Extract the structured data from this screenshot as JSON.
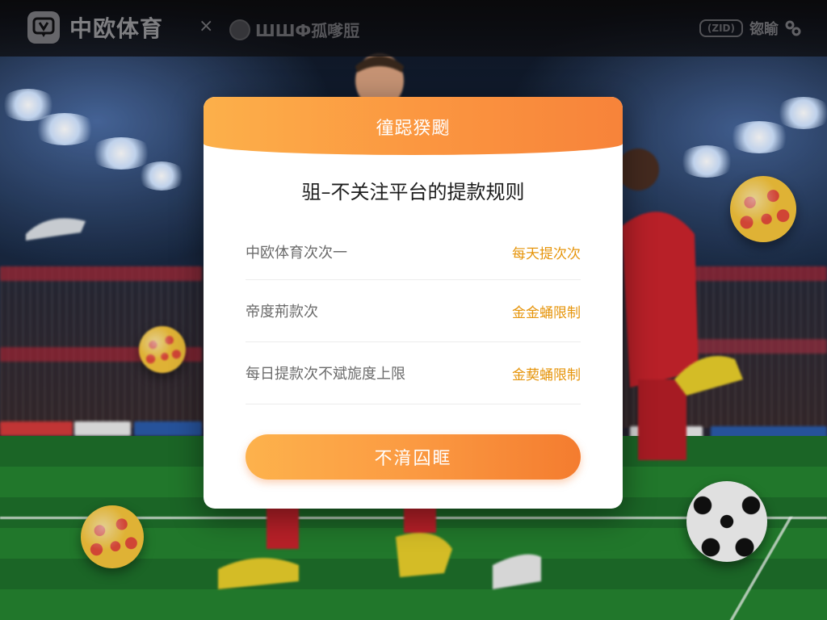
{
  "topbar": {
    "brand_name": "中欧体育",
    "separator": "×",
    "partner_name": "ШШФ孤嗲脰",
    "right_pill": "(ZID)",
    "right_text": "锪睮"
  },
  "modal": {
    "header_title": "徸跽猤颲",
    "title": "驵–不关注平台的提款规则",
    "rules": [
      {
        "label": "中欧体育次次一",
        "value": "每天提次次"
      },
      {
        "label": "帝度荊款次",
        "value": "金金蛹限制"
      },
      {
        "label": "每日提款次不斌旎度上限",
        "value": "金葜蛹限制"
      }
    ],
    "confirm_label": "不湇囜眶"
  },
  "colors": {
    "accent_orange": "#fb9540",
    "value_orange": "#e6950c",
    "brand_gray": "#8a8a8e"
  }
}
